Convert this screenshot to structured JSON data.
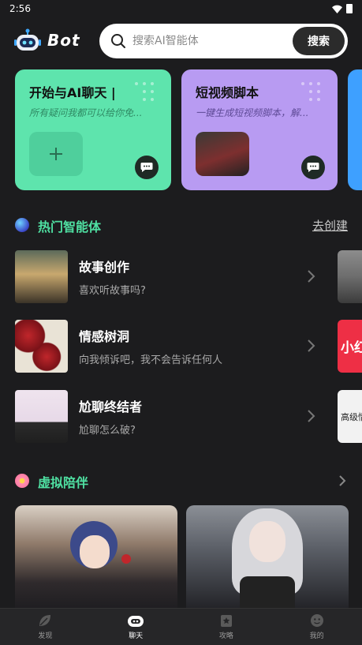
{
  "status_bar": {
    "time": "2:56"
  },
  "header": {
    "logo_text": "Bot",
    "search": {
      "placeholder": "搜索AI智能体",
      "button_label": "搜索"
    }
  },
  "feature_cards": [
    {
      "title": "开始与AI聊天 |",
      "subtitle": "所有疑问我都可以给你免...",
      "bg": "#5ee4ad"
    },
    {
      "title": "短视频脚本",
      "subtitle": "一键生成短视频脚本，解...",
      "bg": "#b89bf2"
    }
  ],
  "hot_agents": {
    "title": "热门智能体",
    "link": "去创建",
    "items": [
      {
        "name": "故事创作",
        "desc": "喜欢听故事吗?"
      },
      {
        "name": "情感树洞",
        "desc": "向我倾诉吧，我不会告诉任何人"
      },
      {
        "name": "尬聊终结者",
        "desc": "尬聊怎么破?"
      }
    ],
    "peek_texts": [
      "小红",
      "高级情"
    ]
  },
  "companion": {
    "title": "虚拟陪伴"
  },
  "tabs": [
    {
      "label": "发现",
      "icon": "leaf-icon"
    },
    {
      "label": "聊天",
      "icon": "chat-bot-icon"
    },
    {
      "label": "攻略",
      "icon": "star-bookmark-icon"
    },
    {
      "label": "我的",
      "icon": "face-icon"
    }
  ],
  "colors": {
    "accent": "#4fe0a2",
    "background": "#1c1c1e"
  }
}
